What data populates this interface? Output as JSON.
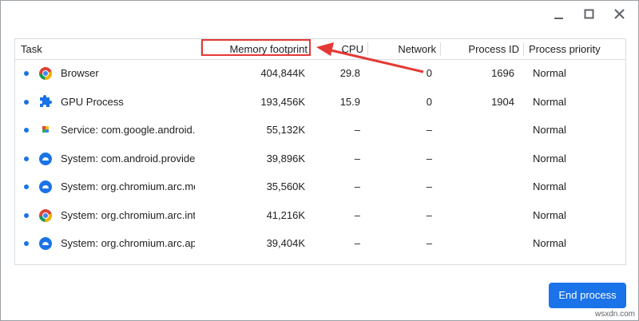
{
  "window_controls": {
    "minimize": "minimize-icon",
    "maximize": "maximize-icon",
    "close": "close-icon"
  },
  "table": {
    "columns": [
      "Task",
      "Memory footprint",
      "CPU",
      "Network",
      "Process ID",
      "Process priority"
    ],
    "rows": [
      {
        "icon": "chrome-icon",
        "task": "Browser",
        "memory": "404,844K",
        "cpu": "29.8",
        "network": "0",
        "pid": "1696",
        "priority": "Normal"
      },
      {
        "icon": "puzzle-icon",
        "task": "GPU Process",
        "memory": "193,456K",
        "cpu": "15.9",
        "network": "0",
        "pid": "1904",
        "priority": "Normal"
      },
      {
        "icon": "android-app-icon",
        "task": "Service: com.google.android.gms",
        "memory": "55,132K",
        "cpu": "–",
        "network": "–",
        "pid": "",
        "priority": "Normal"
      },
      {
        "icon": "system-app-icon",
        "task": "System: com.android.providers.downloads",
        "memory": "39,896K",
        "cpu": "–",
        "network": "–",
        "pid": "",
        "priority": "Normal"
      },
      {
        "icon": "system-app-icon",
        "task": "System: org.chromium.arc.media",
        "memory": "35,560K",
        "cpu": "–",
        "network": "–",
        "pid": "",
        "priority": "Normal"
      },
      {
        "icon": "chrome-icon",
        "task": "System: org.chromium.arc.intent_helper",
        "memory": "41,216K",
        "cpu": "–",
        "network": "–",
        "pid": "",
        "priority": "Normal"
      },
      {
        "icon": "system-app-icon",
        "task": "System: org.chromium.arc.applauncher",
        "memory": "39,404K",
        "cpu": "–",
        "network": "–",
        "pid": "",
        "priority": "Normal"
      }
    ]
  },
  "end_button": "End process",
  "annotation": {
    "color": "#e53935"
  },
  "accent_color": "#1a73e8",
  "watermark": "wsxdn.com"
}
